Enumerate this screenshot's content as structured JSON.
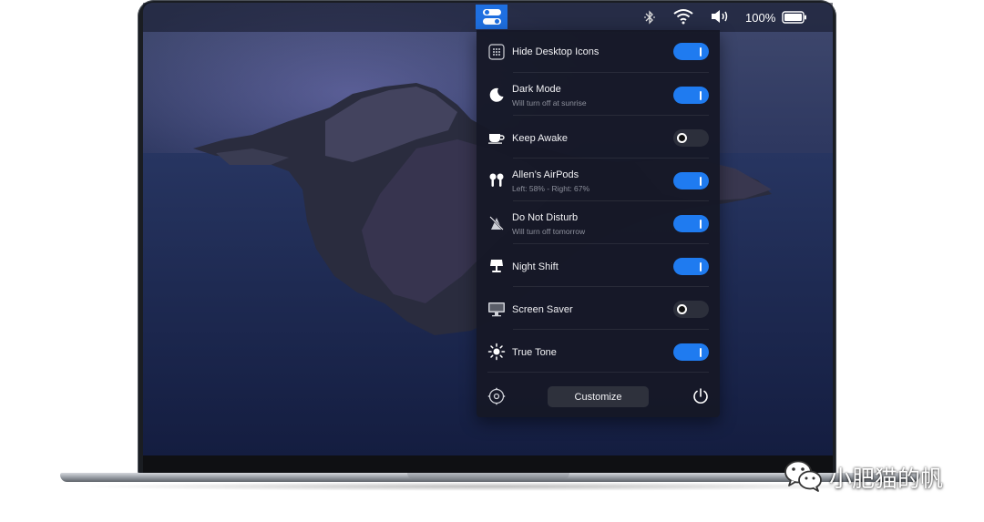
{
  "menubar": {
    "battery_percent": "100%",
    "icons": [
      "bluetooth-icon",
      "wifi-icon",
      "volume-icon",
      "battery-icon"
    ]
  },
  "panel": {
    "items": [
      {
        "label": "Hide Desktop Icons",
        "subtitle": "",
        "icon": "grid-icon",
        "enabled": true
      },
      {
        "label": "Dark Mode",
        "subtitle": "Will turn off at sunrise",
        "icon": "moon-icon",
        "enabled": true
      },
      {
        "label": "Keep Awake",
        "subtitle": "",
        "icon": "coffee-cup-icon",
        "enabled": false
      },
      {
        "label": "Allen’s AirPods",
        "subtitle": "Left: 58% - Right: 67%",
        "icon": "airpods-icon",
        "enabled": true
      },
      {
        "label": "Do Not Disturb",
        "subtitle": "Will turn off tomorrow",
        "icon": "do-not-disturb-icon",
        "enabled": true
      },
      {
        "label": "Night Shift",
        "subtitle": "",
        "icon": "lamp-icon",
        "enabled": true
      },
      {
        "label": "Screen Saver",
        "subtitle": "",
        "icon": "monitor-icon",
        "enabled": false
      },
      {
        "label": "True Tone",
        "subtitle": "",
        "icon": "sun-icon",
        "enabled": true
      }
    ],
    "customize_label": "Customize"
  },
  "watermark": {
    "text": "小肥猫的帆"
  },
  "colors": {
    "accent": "#1f7bf0",
    "panel_bg": "#16182a"
  }
}
